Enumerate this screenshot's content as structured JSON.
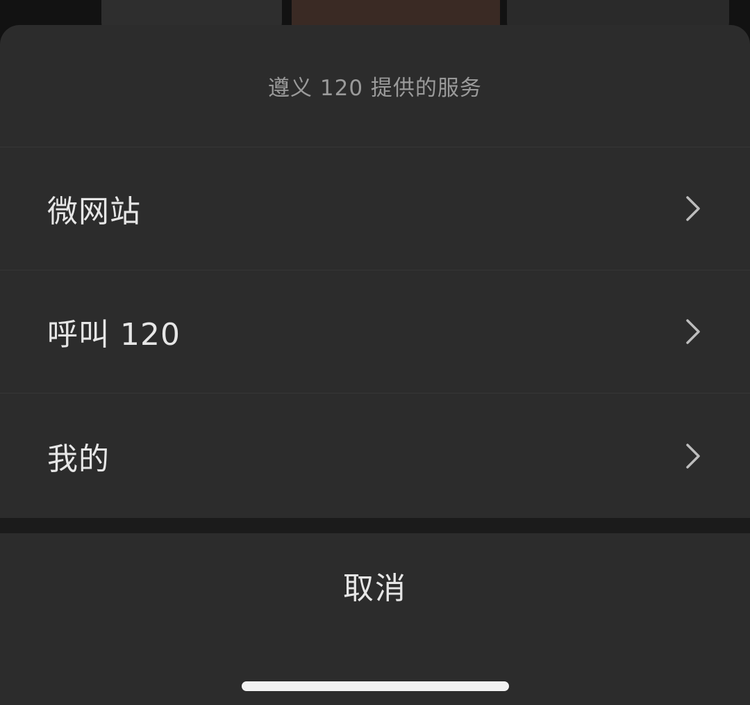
{
  "sheet": {
    "title": "遵义 120 提供的服务",
    "options": [
      {
        "label": "微网站",
        "icon": "chevron-right-icon"
      },
      {
        "label": "呼叫 120",
        "icon": "chevron-right-icon"
      },
      {
        "label": "我的",
        "icon": "chevron-right-icon"
      }
    ],
    "cancel_label": "取消"
  }
}
